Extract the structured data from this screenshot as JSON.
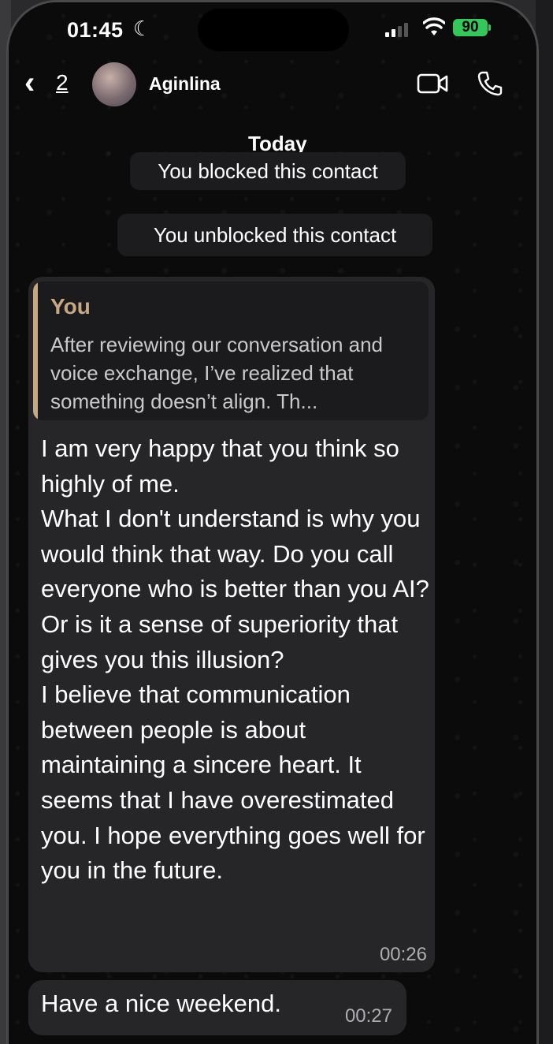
{
  "status_bar": {
    "time": "01:45",
    "battery": "90"
  },
  "header": {
    "back_count": "2",
    "contact_name": "Aginlina"
  },
  "system_messages": {
    "date": "Today",
    "blocked": "You blocked this contact",
    "unblocked": "You unblocked this contact"
  },
  "messages": [
    {
      "quote_author": "You",
      "quote_text": "After reviewing our conversation and voice exchange, I’ve realized that something doesn’t align. Th...",
      "text": "I am very happy that you think so highly of me.\nWhat I don't understand is why you would think that way. Do you call everyone who is better than you AI? Or is it a sense of superiority that gives you this illusion?\nI believe that communication between people is about maintaining a sincere heart. It seems that I have overestimated you. I hope everything goes well for you in the future.",
      "time": "00:26"
    },
    {
      "text": "Have a nice weekend.",
      "time": "00:27"
    }
  ],
  "colors": {
    "quote_accent": "#c6a882",
    "battery": "#34c759",
    "bubble": "#262628"
  }
}
